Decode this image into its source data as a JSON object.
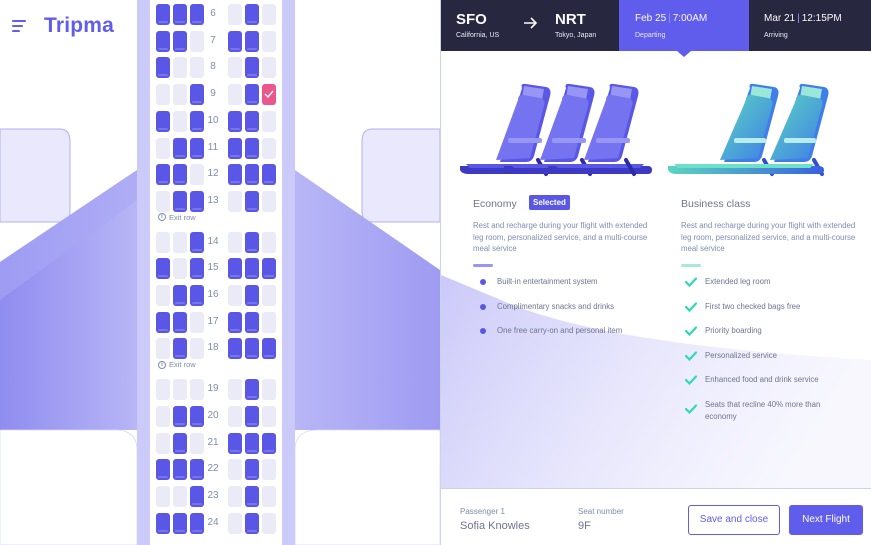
{
  "app": {
    "name": "Tripma"
  },
  "colors": {
    "brand": "#605dec",
    "header_bg": "#27273f",
    "seat_available": "#5a57e6",
    "seat_unavailable": "#ebebf8",
    "seat_selected": "#eb568c",
    "business_accent": "#2ed9b8"
  },
  "seat_map": {
    "exit_label": "Exit row",
    "rows": [
      {
        "num": "6",
        "seats": [
          "A",
          "A",
          "A",
          "U",
          "A",
          "U"
        ]
      },
      {
        "num": "7",
        "seats": [
          "A",
          "A",
          "U",
          "A",
          "A",
          "U"
        ]
      },
      {
        "num": "8",
        "seats": [
          "A",
          "U",
          "U",
          "U",
          "A",
          "U"
        ]
      },
      {
        "num": "9",
        "seats": [
          "U",
          "U",
          "A",
          "U",
          "A",
          "S"
        ]
      },
      {
        "num": "10",
        "seats": [
          "A",
          "U",
          "A",
          "A",
          "A",
          "U"
        ]
      },
      {
        "num": "11",
        "seats": [
          "U",
          "A",
          "A",
          "A",
          "A",
          "U"
        ]
      },
      {
        "num": "12",
        "seats": [
          "A",
          "A",
          "U",
          "A",
          "A",
          "A"
        ]
      },
      {
        "num": "13",
        "seats": [
          "U",
          "A",
          "A",
          "U",
          "A",
          "U"
        ]
      },
      {
        "num": "14",
        "seats": [
          "U",
          "U",
          "A",
          "U",
          "A",
          "U"
        ]
      },
      {
        "num": "15",
        "seats": [
          "A",
          "U",
          "A",
          "A",
          "A",
          "A"
        ]
      },
      {
        "num": "16",
        "seats": [
          "U",
          "A",
          "A",
          "U",
          "A",
          "U"
        ]
      },
      {
        "num": "17",
        "seats": [
          "A",
          "A",
          "U",
          "A",
          "A",
          "U"
        ]
      },
      {
        "num": "18",
        "seats": [
          "U",
          "A",
          "U",
          "A",
          "A",
          "A"
        ]
      },
      {
        "num": "19",
        "seats": [
          "U",
          "U",
          "U",
          "U",
          "A",
          "U"
        ]
      },
      {
        "num": "20",
        "seats": [
          "U",
          "A",
          "A",
          "U",
          "A",
          "U"
        ]
      },
      {
        "num": "21",
        "seats": [
          "U",
          "A",
          "U",
          "A",
          "A",
          "A"
        ]
      },
      {
        "num": "22",
        "seats": [
          "A",
          "A",
          "A",
          "U",
          "A",
          "U"
        ]
      },
      {
        "num": "23",
        "seats": [
          "U",
          "U",
          "A",
          "U",
          "A",
          "U"
        ]
      },
      {
        "num": "24",
        "seats": [
          "A",
          "A",
          "A",
          "U",
          "A",
          "U"
        ]
      }
    ]
  },
  "flight": {
    "from": {
      "code": "SFO",
      "place": "California, US"
    },
    "to": {
      "code": "NRT",
      "place": "Tokyo, Japan"
    },
    "departing": {
      "date": "Feb 25",
      "time": "7:00AM",
      "label": "Departing"
    },
    "arriving": {
      "date": "Mar 21",
      "time": "12:15PM",
      "label": "Arriving"
    }
  },
  "classes": {
    "economy": {
      "name": "Economy",
      "badge": "Selected",
      "description": "Rest and recharge during your flight with extended leg room, personalized service, and a multi-course meal service",
      "features": [
        "Built-in entertainment system",
        "Complimentary snacks and drinks",
        "One free carry-on and personal item"
      ]
    },
    "business": {
      "name": "Business class",
      "description": "Rest and recharge during your flight with extended leg room, personalized service, and a multi-course meal service",
      "features": [
        "Extended leg room",
        "First two checked bags free",
        "Priority boarding",
        "Personalized service",
        "Enhanced food and drink service",
        "Seats that recline 40% more than economy"
      ]
    }
  },
  "footer": {
    "passenger_label": "Passenger 1",
    "passenger_name": "Sofia Knowles",
    "seat_label": "Seat number",
    "seat_value": "9F",
    "save_button": "Save and close",
    "next_button": "Next Flight"
  }
}
